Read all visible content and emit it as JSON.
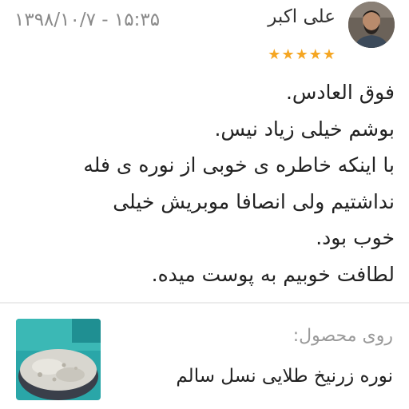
{
  "review": {
    "author": "علی اکبر",
    "date": "۱۳۹۸/۱۰/۷ - ۱۵:۳۵",
    "rating": 5,
    "rating_max": 5,
    "star_color": "#f5a623",
    "comment_lines": [
      "فوق العادس.",
      "بوشم خیلی زیاد نیس.",
      "با اینکه خاطره ی خوبی از نوره ی فله",
      "نداشتیم ولی انصافا موبریش خیلی",
      "خوب بود.",
      "لطافت خوبیم به پوست میده."
    ]
  },
  "product": {
    "label": "روی محصول:",
    "name": "نوره زرنیخ طلایی نسل سالم"
  }
}
